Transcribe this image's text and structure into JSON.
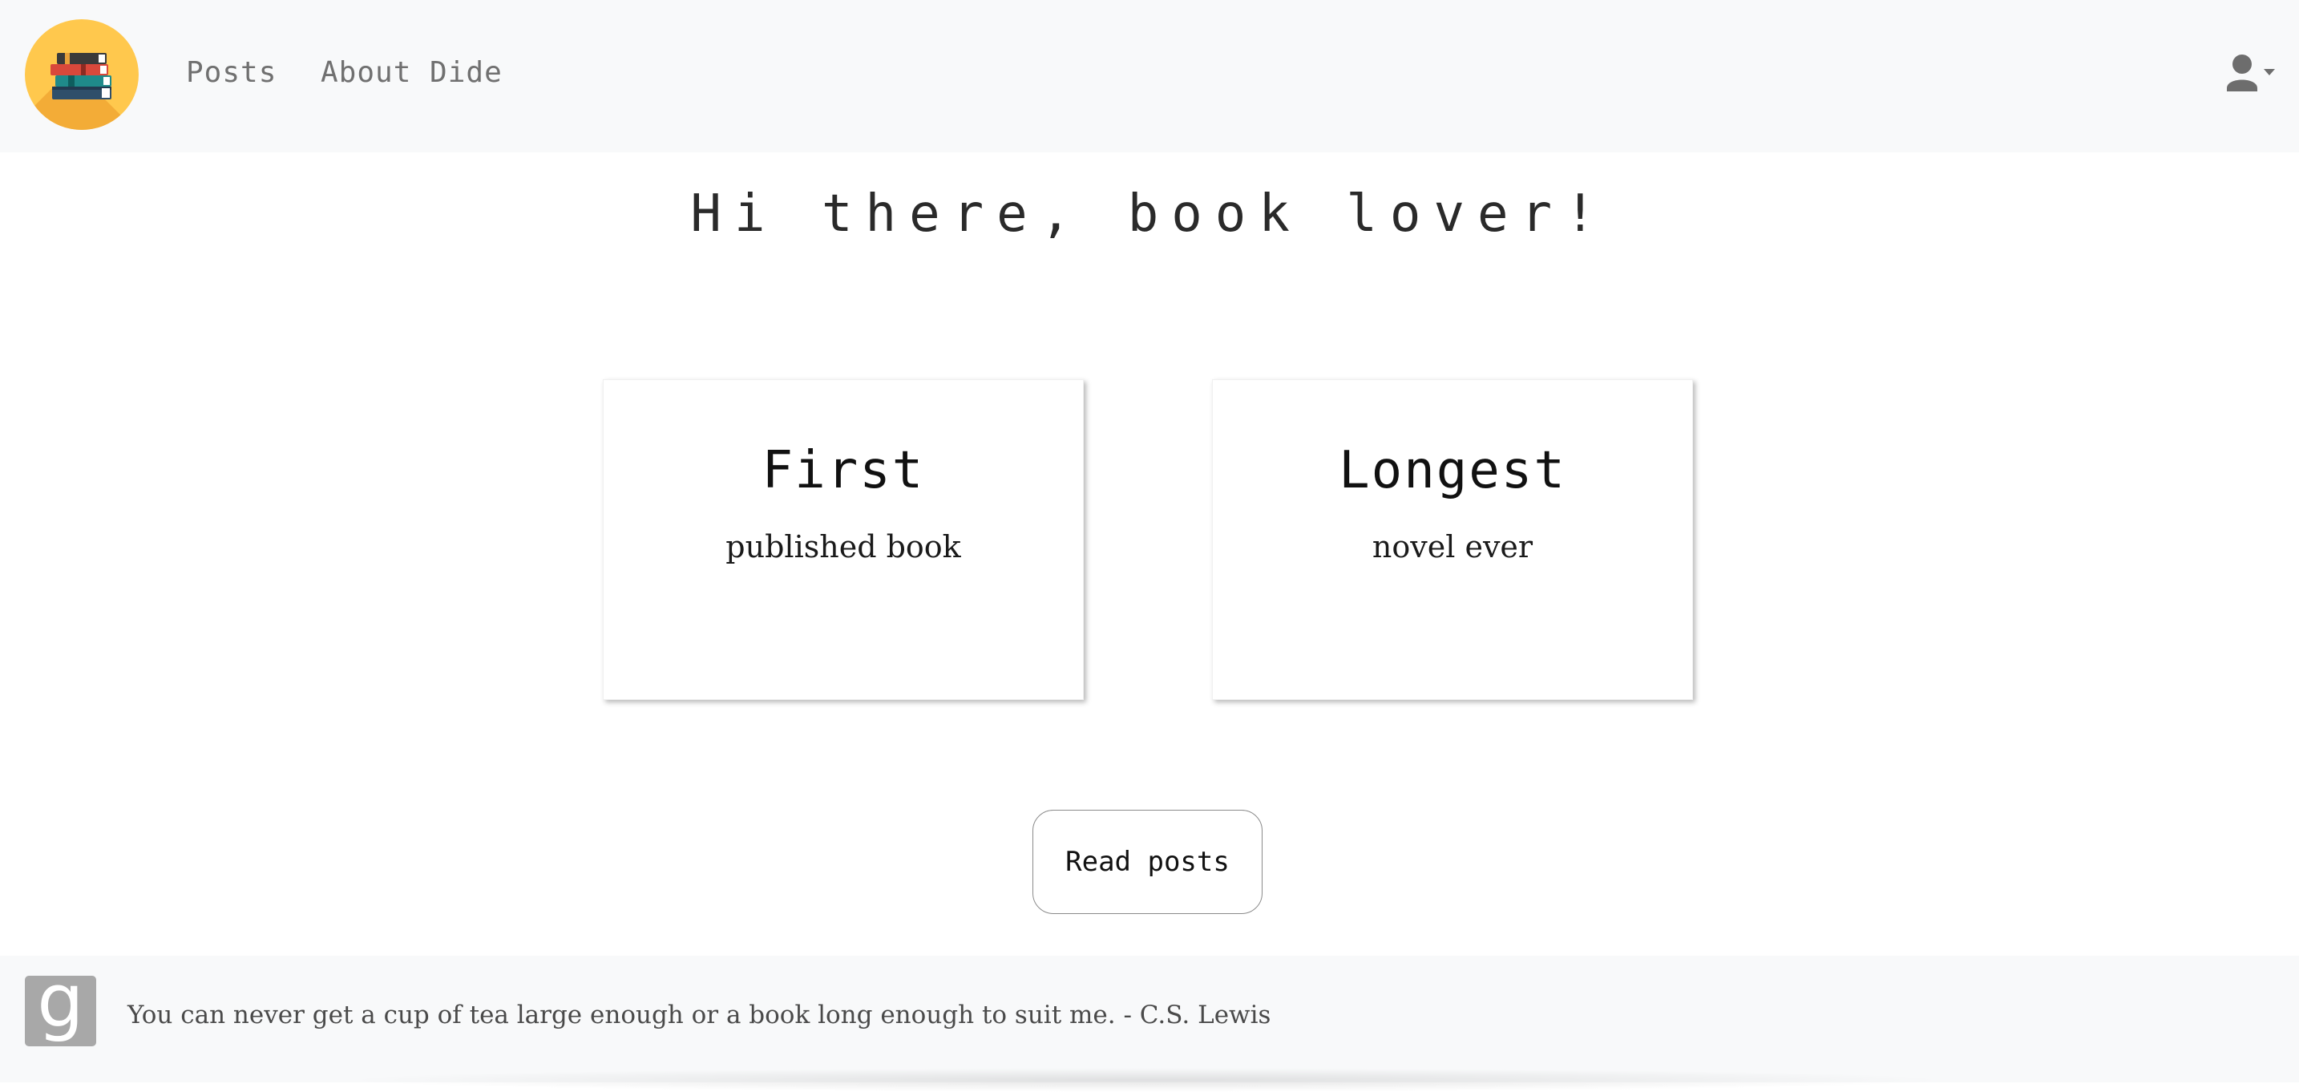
{
  "header": {
    "logo_icon": "books-logo-icon",
    "nav": [
      {
        "label": "Posts"
      },
      {
        "label": "About Dide"
      }
    ],
    "user_menu_icon": "user-icon"
  },
  "main": {
    "greeting": "Hi there, book lover!",
    "cards": [
      {
        "title": "First",
        "subtitle": "published book"
      },
      {
        "title": "Longest",
        "subtitle": "novel ever"
      }
    ],
    "read_button_label": "Read posts"
  },
  "footer": {
    "goodreads_icon": "goodreads-icon",
    "goodreads_letter": "g",
    "quote": "You can never get a cup of tea large enough or a book long enough to suit me. - C.S. Lewis"
  },
  "colors": {
    "header_bg": "#f8f9fa",
    "logo_bg": "#ffc84d",
    "nav_text": "#707070",
    "button_border": "#8a8a8a"
  }
}
